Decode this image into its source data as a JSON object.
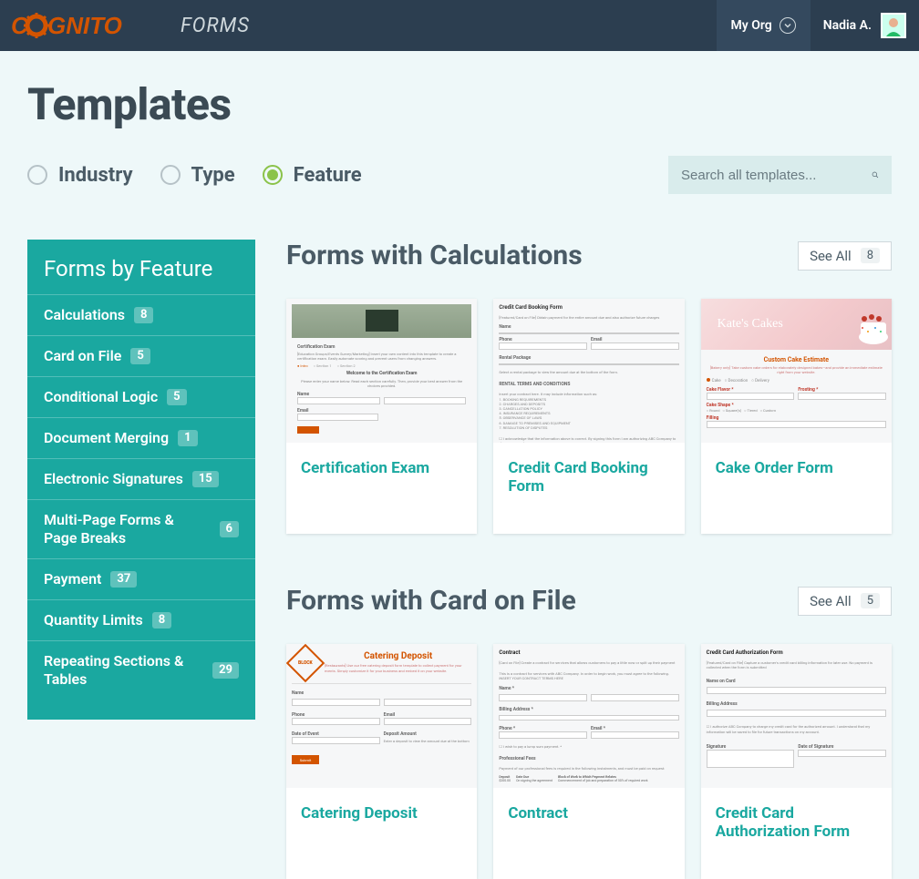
{
  "header": {
    "logo_main": "Cognito",
    "logo_suffix": "FORMS",
    "org_label": "My Org",
    "user_name": "Nadia A."
  },
  "page": {
    "title": "Templates",
    "search_placeholder": "Search all templates..."
  },
  "filter_tabs": [
    {
      "label": "Industry",
      "active": false
    },
    {
      "label": "Type",
      "active": false
    },
    {
      "label": "Feature",
      "active": true
    }
  ],
  "sidebar": {
    "title": "Forms by Feature",
    "items": [
      {
        "label": "Calculations",
        "count": "8"
      },
      {
        "label": "Card on File",
        "count": "5"
      },
      {
        "label": "Conditional Logic",
        "count": "5"
      },
      {
        "label": "Document Merging",
        "count": "1"
      },
      {
        "label": "Electronic Signatures",
        "count": "15"
      },
      {
        "label": "Multi-Page Forms & Page Breaks",
        "count": "6"
      },
      {
        "label": "Payment",
        "count": "37"
      },
      {
        "label": "Quantity Limits",
        "count": "8"
      },
      {
        "label": "Repeating Sections & Tables",
        "count": "29"
      }
    ]
  },
  "sections": [
    {
      "title": "Forms with Calculations",
      "see_all_label": "See All",
      "see_all_count": "8",
      "cards": [
        {
          "title": "Certification Exam"
        },
        {
          "title": "Credit Card Booking Form"
        },
        {
          "title": "Cake Order Form"
        }
      ]
    },
    {
      "title": "Forms with Card on File",
      "see_all_label": "See All",
      "see_all_count": "5",
      "cards": [
        {
          "title": "Catering Deposit"
        },
        {
          "title": "Contract"
        },
        {
          "title": "Credit Card Authorization Form"
        }
      ]
    }
  ],
  "thumbs": {
    "cert_exam_title": "Certification Exam",
    "cert_exam_welcome": "Welcome to the Certification Exam",
    "cc_booking_title": "Credit Card Booking Form",
    "cc_booking_terms": "RENTAL TERMS AND CONDITIONS",
    "cake_brand": "Kate's Cakes",
    "cake_subtitle": "Custom Cake Estimate",
    "cake_flavor": "Cake Flavor",
    "cake_frosting": "Frosting",
    "cake_shape": "Cake Shape",
    "cake_filling": "Filling",
    "catering_title": "Catering Deposit",
    "catering_fields": {
      "name": "Name",
      "phone": "Phone",
      "email": "Email",
      "date": "Date of Event",
      "deposit": "Deposit Amount",
      "submit": "Submit"
    },
    "contract_title": "Contract",
    "contract_billing": "Billing Address",
    "contract_phone": "Phone",
    "contract_email": "Email",
    "contract_fees": "Professional Fees",
    "ccauth_title": "Credit Card Authorization Form",
    "ccauth_name": "Name on Card",
    "ccauth_billing": "Billing Address",
    "ccauth_sig": "Signature",
    "ccauth_date": "Date of Signature"
  }
}
